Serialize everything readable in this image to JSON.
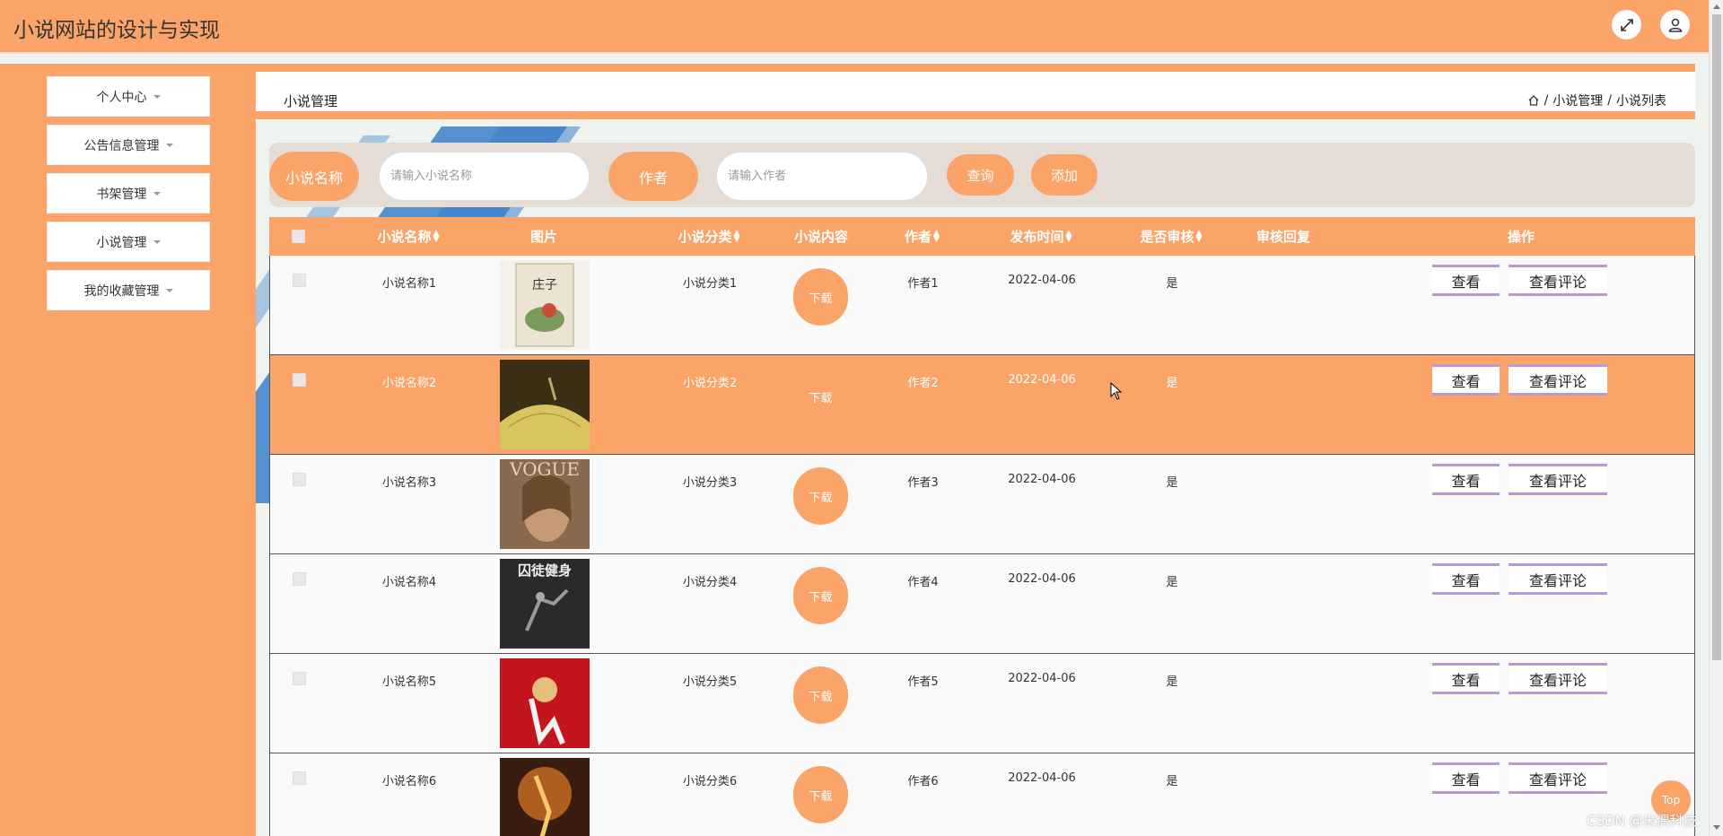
{
  "app": {
    "title": "小说网站的设计与实现"
  },
  "top_icons": {
    "fullscreen": "fullscreen-icon",
    "user": "user-icon"
  },
  "sidebar": {
    "items": [
      {
        "label": "个人中心"
      },
      {
        "label": "公告信息管理"
      },
      {
        "label": "书架管理"
      },
      {
        "label": "小说管理"
      },
      {
        "label": "我的收藏管理"
      }
    ]
  },
  "header": {
    "title": "小说管理",
    "breadcrumb": [
      "小说管理",
      "小说列表"
    ],
    "separator": "/"
  },
  "search": {
    "name_label": "小说名称",
    "name_placeholder": "请输入小说名称",
    "author_label": "作者",
    "author_placeholder": "请输入作者",
    "query_button": "查询",
    "add_button": "添加"
  },
  "table": {
    "columns": [
      "小说名称",
      "图片",
      "小说分类",
      "小说内容",
      "作者",
      "发布时间",
      "是否审核",
      "审核回复",
      "操作"
    ],
    "rows": [
      {
        "name": "小说名称1",
        "category": "小说分类1",
        "content_btn": "下载",
        "author": "作者1",
        "date": "2022-04-06",
        "approved": "是",
        "reply": "",
        "view": "查看",
        "comments": "查看评论"
      },
      {
        "name": "小说名称2",
        "category": "小说分类2",
        "content_btn": "下载",
        "author": "作者2",
        "date": "2022-04-06",
        "approved": "是",
        "reply": "",
        "view": "查看",
        "comments": "查看评论"
      },
      {
        "name": "小说名称3",
        "category": "小说分类3",
        "content_btn": "下载",
        "author": "作者3",
        "date": "2022-04-06",
        "approved": "是",
        "reply": "",
        "view": "查看",
        "comments": "查看评论"
      },
      {
        "name": "小说名称4",
        "category": "小说分类4",
        "content_btn": "下载",
        "author": "作者4",
        "date": "2022-04-06",
        "approved": "是",
        "reply": "",
        "view": "查看",
        "comments": "查看评论"
      },
      {
        "name": "小说名称5",
        "category": "小说分类5",
        "content_btn": "下载",
        "author": "作者5",
        "date": "2022-04-06",
        "approved": "是",
        "reply": "",
        "view": "查看",
        "comments": "查看评论"
      },
      {
        "name": "小说名称6",
        "category": "小说分类6",
        "content_btn": "下载",
        "author": "作者6",
        "date": "2022-04-06",
        "approved": "是",
        "reply": "",
        "view": "查看",
        "comments": "查看评论"
      }
    ]
  },
  "cover_texts": [
    "庄子",
    "VOGUE",
    "囚徒健身"
  ],
  "back_to_top": "Top",
  "watermark": "CSDN @米偶科技",
  "colors": {
    "accent": "#fba46a",
    "action_border": "#b899d0",
    "stripe": "#3a7fc8"
  }
}
